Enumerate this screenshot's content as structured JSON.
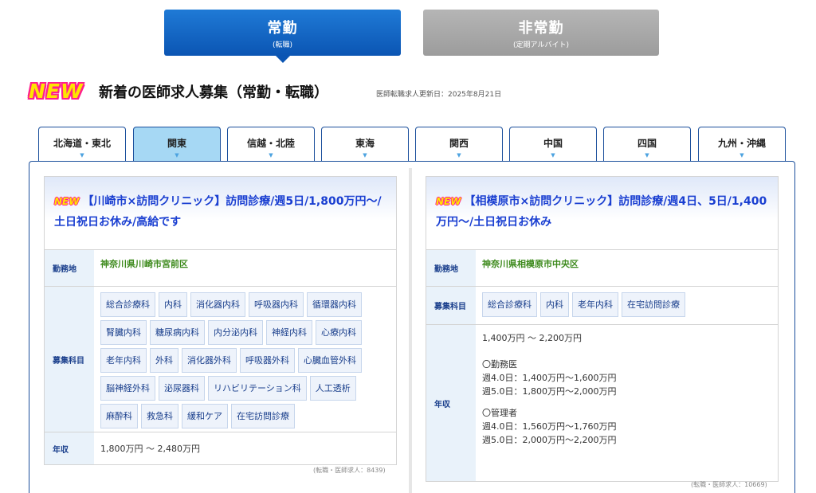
{
  "toggle": {
    "fulltime": {
      "label": "常勤",
      "sub": "(転職)"
    },
    "parttime": {
      "label": "非常勤",
      "sub": "(定期アルバイト)"
    }
  },
  "heading": {
    "badge": "NEW",
    "title": "新着の医師求人募集（常勤・転職）",
    "updated": "医師転職求人更新日：2025年8月21日"
  },
  "tabs": [
    {
      "label": "北海道・東北"
    },
    {
      "label": "関東"
    },
    {
      "label": "信越・北陸"
    },
    {
      "label": "東海"
    },
    {
      "label": "関西"
    },
    {
      "label": "中国"
    },
    {
      "label": "四国"
    },
    {
      "label": "九州・沖縄"
    }
  ],
  "active_tab": "関東",
  "jobs": [
    {
      "badge": "NEW",
      "title": "【川崎市×訪問クリニック】訪問診療/週5日/1,800万円～/土日祝日お休み/高給です",
      "location_label": "勤務地",
      "location": "神奈川県川崎市宮前区",
      "depts_label": "募集科目",
      "depts": [
        "総合診療科",
        "内科",
        "消化器内科",
        "呼吸器内科",
        "循環器内科",
        "腎臓内科",
        "糖尿病内科",
        "内分泌内科",
        "神経内科",
        "心療内科",
        "老年内科",
        "外科",
        "消化器外科",
        "呼吸器外科",
        "心臓血管外科",
        "脳神経外科",
        "泌尿器科",
        "リハビリテーション科",
        "人工透析",
        "麻酔科",
        "救急科",
        "緩和ケア",
        "在宅訪問診療"
      ],
      "salary_label": "年収",
      "salary": [
        "1,800万円 ～ 2,480万円"
      ],
      "note": "(転職・医師求人：8439)"
    },
    {
      "badge": "NEW",
      "title": "【相模原市×訪問クリニック】訪問診療/週4日、5日/1,400万円～/土日祝日お休み",
      "location_label": "勤務地",
      "location": "神奈川県相模原市中央区",
      "depts_label": "募集科目",
      "depts": [
        "総合診療科",
        "内科",
        "老年内科",
        "在宅訪問診療"
      ],
      "salary_label": "年収",
      "salary": [
        "1,400万円 ～ 2,200万円",
        "",
        "〇勤務医",
        "週4.0日：1,400万円～1,600万円",
        "週5.0日：1,800万円～2,000万円",
        "",
        "〇管理者",
        "週4.0日：1,560万円～1,760万円",
        "週5.0日：2,000万円～2,200万円"
      ],
      "note": "(転職・医師求人：10669)"
    }
  ]
}
